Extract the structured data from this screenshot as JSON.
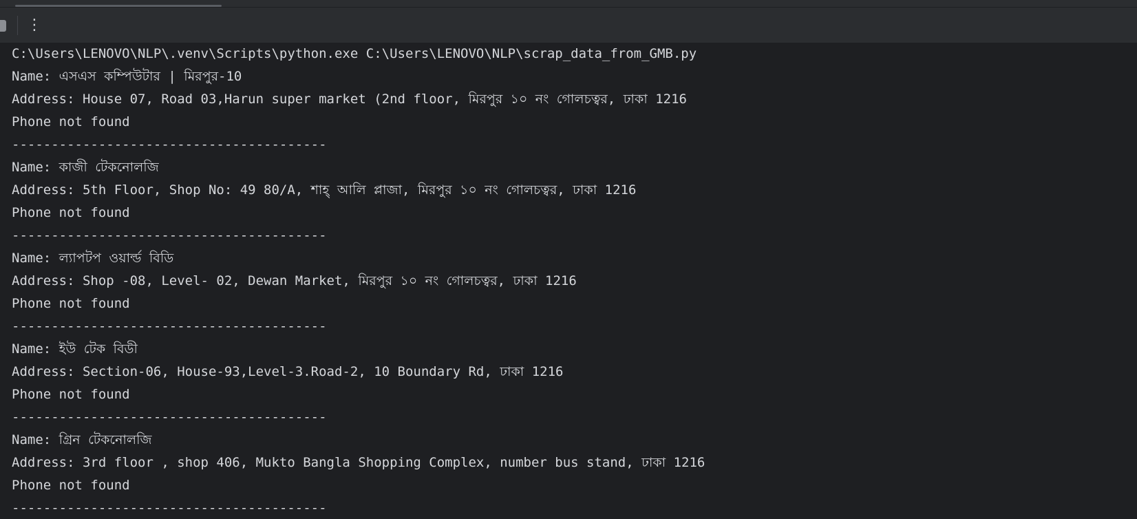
{
  "toolbar": {
    "stop_icon": "stop-square-icon",
    "more_icon": "vertical-ellipsis-icon",
    "more_glyph": "⋮"
  },
  "colors": {
    "background": "#1e1f22",
    "toolbar": "#2b2d30",
    "text": "#d5d7db"
  },
  "console": {
    "lines": [
      "C:\\Users\\LENOVO\\NLP\\.venv\\Scripts\\python.exe C:\\Users\\LENOVO\\NLP\\scrap_data_from_GMB.py",
      "Name: এসএস কম্পিউটার | মিরপুর-10",
      "Address: House 07, Road 03,Harun super market (2nd floor, মিরপুর ১০ নং গোলচত্বর, ঢাকা 1216",
      "Phone not found",
      "----------------------------------------",
      "Name: কাজী টেকনোলজি",
      "Address: 5th Floor, Shop No: 49 80/A, শাহ্ আলি প্লাজা, মিরপুর ১০ নং গোলচত্বর, ঢাকা 1216",
      "Phone not found",
      "----------------------------------------",
      "Name: ল্যাপটপ ওয়ার্ল্ড বিডি",
      "Address: Shop -08, Level- 02, Dewan Market, মিরপুর ১০ নং গোলচত্বর, ঢাকা 1216",
      "Phone not found",
      "----------------------------------------",
      "Name: ইউ টেক বিডী",
      "Address: Section-06, House-93,Level-3.Road-2, 10 Boundary Rd, ঢাকা 1216",
      "Phone not found",
      "----------------------------------------",
      "Name: গ্রিন টেকনোলজি",
      "Address: 3rd floor , shop 406, Mukto Bangla Shopping Complex, number bus stand, ঢাকা 1216",
      "Phone not found",
      "----------------------------------------"
    ]
  }
}
